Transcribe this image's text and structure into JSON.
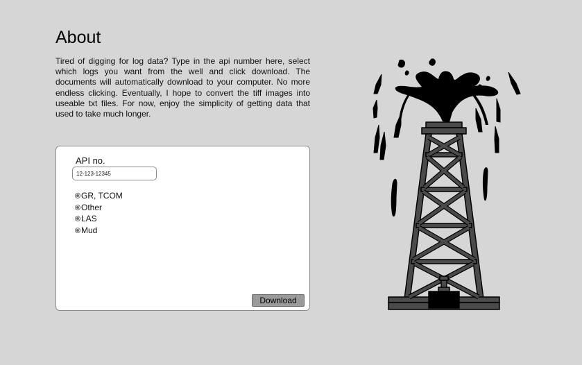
{
  "about": {
    "title": "About",
    "description": "Tired of digging for log data? Type in the api number here, select which logs you want from the well and click download. The documents will automatically download to your computer. No more endless clicking. Eventually, I hope to convert the tiff images into useable txt files. For now, enjoy the simplicity of getting data that used to take much longer."
  },
  "form": {
    "api_label": "API no.",
    "api_value": "12-123-12345",
    "log_options": [
      {
        "label": "GR, TCOM"
      },
      {
        "label": "Other"
      },
      {
        "label": "LAS"
      },
      {
        "label": "Mud"
      }
    ],
    "download_label": "Download"
  },
  "illustration": {
    "icon": "oil-derrick-gusher-icon",
    "colors": {
      "oil": "#000000",
      "steel": "#4a4a4a",
      "outline": "#000000"
    }
  }
}
